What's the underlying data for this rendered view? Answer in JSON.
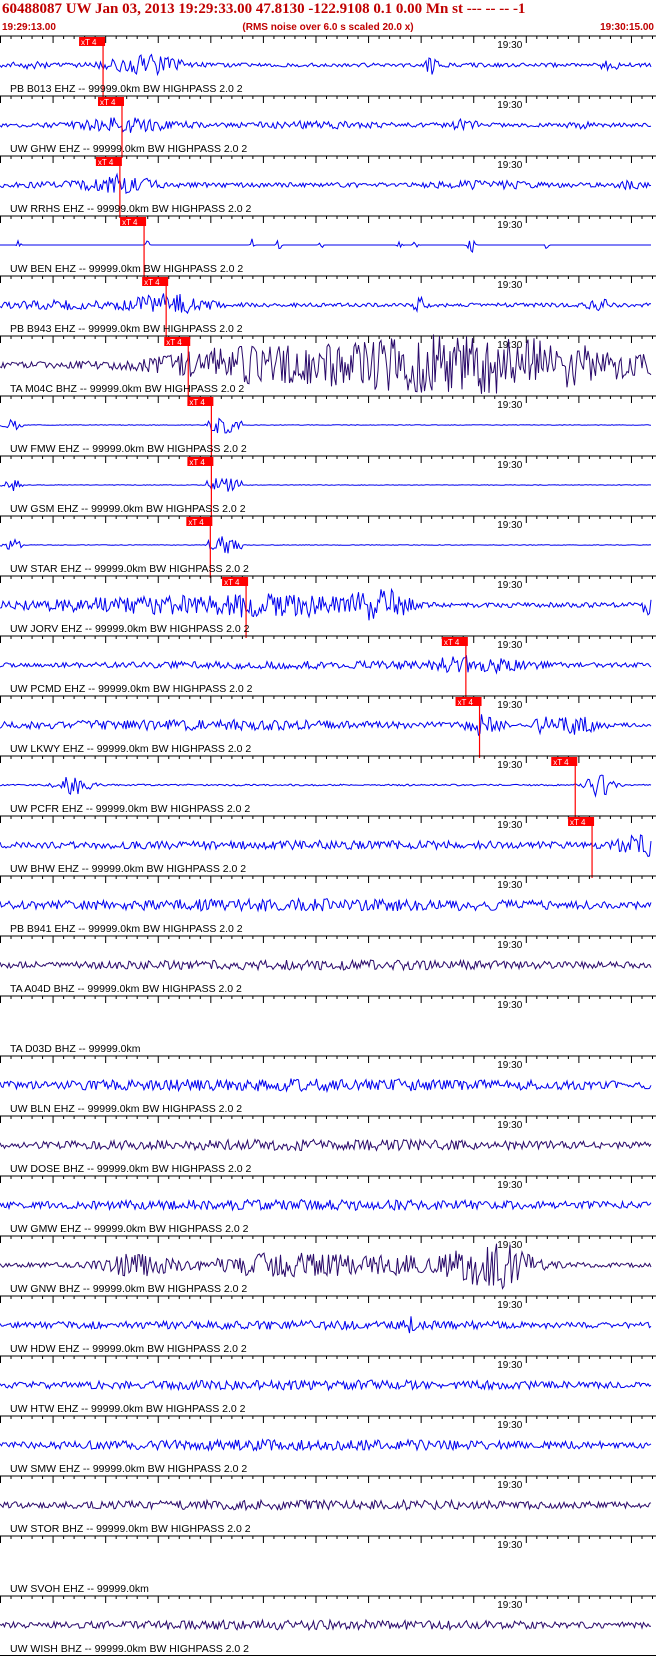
{
  "header": {
    "title": "60488087 UW Jan 03, 2013 19:29:33.00   47.8130 -122.9108  0.1 0.00 Mn st --- -- --  -1",
    "start_time": "19:29:13.00",
    "noise_note": "(RMS noise over 6.0 s scaled 20.0 x)",
    "end_time": "19:30:15.00"
  },
  "colors": {
    "header_text": "#c00000",
    "trace_blue": "#0000ee",
    "trace_navy": "#2a0a6a",
    "pick_marker": "#ff0000",
    "grid": "#000000"
  },
  "chart_data": {
    "type": "seismogram",
    "time_axis": {
      "start": "19:29:13.00",
      "end": "19:30:15.00",
      "minute_tick_label": "19:30"
    },
    "pick_label": "xT 4",
    "traces": [
      {
        "label": "PB B013 EHZ -- 99999.0km BW  HIGHPASS  2.0  2",
        "color": "blue",
        "pick_time_s": 9.8
      },
      {
        "label": "UW GHW EHZ -- 99999.0km BW  HIGHPASS  2.0  2",
        "color": "blue",
        "pick_time_s": 11.6
      },
      {
        "label": "UW RRHS EHZ -- 99999.0km BW  HIGHPASS  2.0  2",
        "color": "blue",
        "pick_time_s": 11.4
      },
      {
        "label": "UW BEN EHZ -- 99999.0km BW  HIGHPASS  2.0  2",
        "color": "blue",
        "pick_time_s": 13.7
      },
      {
        "label": "PB B943 EHZ -- 99999.0km BW  HIGHPASS  2.0  2",
        "color": "blue",
        "pick_time_s": 15.8
      },
      {
        "label": "TA M04C BHZ -- 99999.0km BW  HIGHPASS  2.0  2",
        "color": "navy",
        "pick_time_s": 17.9
      },
      {
        "label": "UW FMW EHZ -- 99999.0km BW  HIGHPASS  2.0  2",
        "color": "blue",
        "pick_time_s": 20.1
      },
      {
        "label": "UW GSM EHZ -- 99999.0km BW  HIGHPASS  2.0  2",
        "color": "blue",
        "pick_time_s": 20.1
      },
      {
        "label": "UW STAR EHZ -- 99999.0km BW  HIGHPASS  2.0  2",
        "color": "blue",
        "pick_time_s": 20.0
      },
      {
        "label": "UW JORV EHZ -- 99999.0km BW  HIGHPASS  2.0  2",
        "color": "blue",
        "pick_time_s": 23.4
      },
      {
        "label": "UW PCMD EHZ -- 99999.0km BW  HIGHPASS  2.0  2",
        "color": "blue",
        "pick_time_s": 44.3
      },
      {
        "label": "UW LKWY EHZ -- 99999.0km BW  HIGHPASS  2.0  2",
        "color": "blue",
        "pick_time_s": 45.6
      },
      {
        "label": "UW PCFR EHZ -- 99999.0km BW  HIGHPASS  2.0  2",
        "color": "blue",
        "pick_time_s": 54.7
      },
      {
        "label": "UW BHW EHZ -- 99999.0km BW  HIGHPASS  2.0  2",
        "color": "blue",
        "pick_time_s": 56.3
      },
      {
        "label": "PB B941 EHZ -- 99999.0km BW  HIGHPASS  2.0  2",
        "color": "blue"
      },
      {
        "label": "TA A04D BHZ -- 99999.0km BW  HIGHPASS  2.0  2",
        "color": "navy"
      },
      {
        "label": "TA D03D BHZ -- 99999.0km",
        "color": "none"
      },
      {
        "label": "UW BLN EHZ -- 99999.0km BW  HIGHPASS  2.0  2",
        "color": "blue"
      },
      {
        "label": "UW DOSE BHZ -- 99999.0km BW  HIGHPASS  2.0  2",
        "color": "navy"
      },
      {
        "label": "UW GMW EHZ -- 99999.0km BW  HIGHPASS  2.0  2",
        "color": "blue"
      },
      {
        "label": "UW GNW BHZ -- 99999.0km BW  HIGHPASS  2.0  2",
        "color": "navy"
      },
      {
        "label": "UW HDW EHZ -- 99999.0km BW  HIGHPASS  2.0  2",
        "color": "blue"
      },
      {
        "label": "UW HTW EHZ -- 99999.0km BW  HIGHPASS  2.0  2",
        "color": "blue"
      },
      {
        "label": "UW SMW EHZ -- 99999.0km BW  HIGHPASS  2.0  2",
        "color": "blue"
      },
      {
        "label": "UW STOR BHZ -- 99999.0km BW  HIGHPASS  2.0  2",
        "color": "navy"
      },
      {
        "label": "UW SVOH EHZ -- 99999.0km",
        "color": "none"
      },
      {
        "label": "UW WISH BHZ -- 99999.0km BW  HIGHPASS  2.0  2",
        "color": "navy"
      }
    ]
  }
}
